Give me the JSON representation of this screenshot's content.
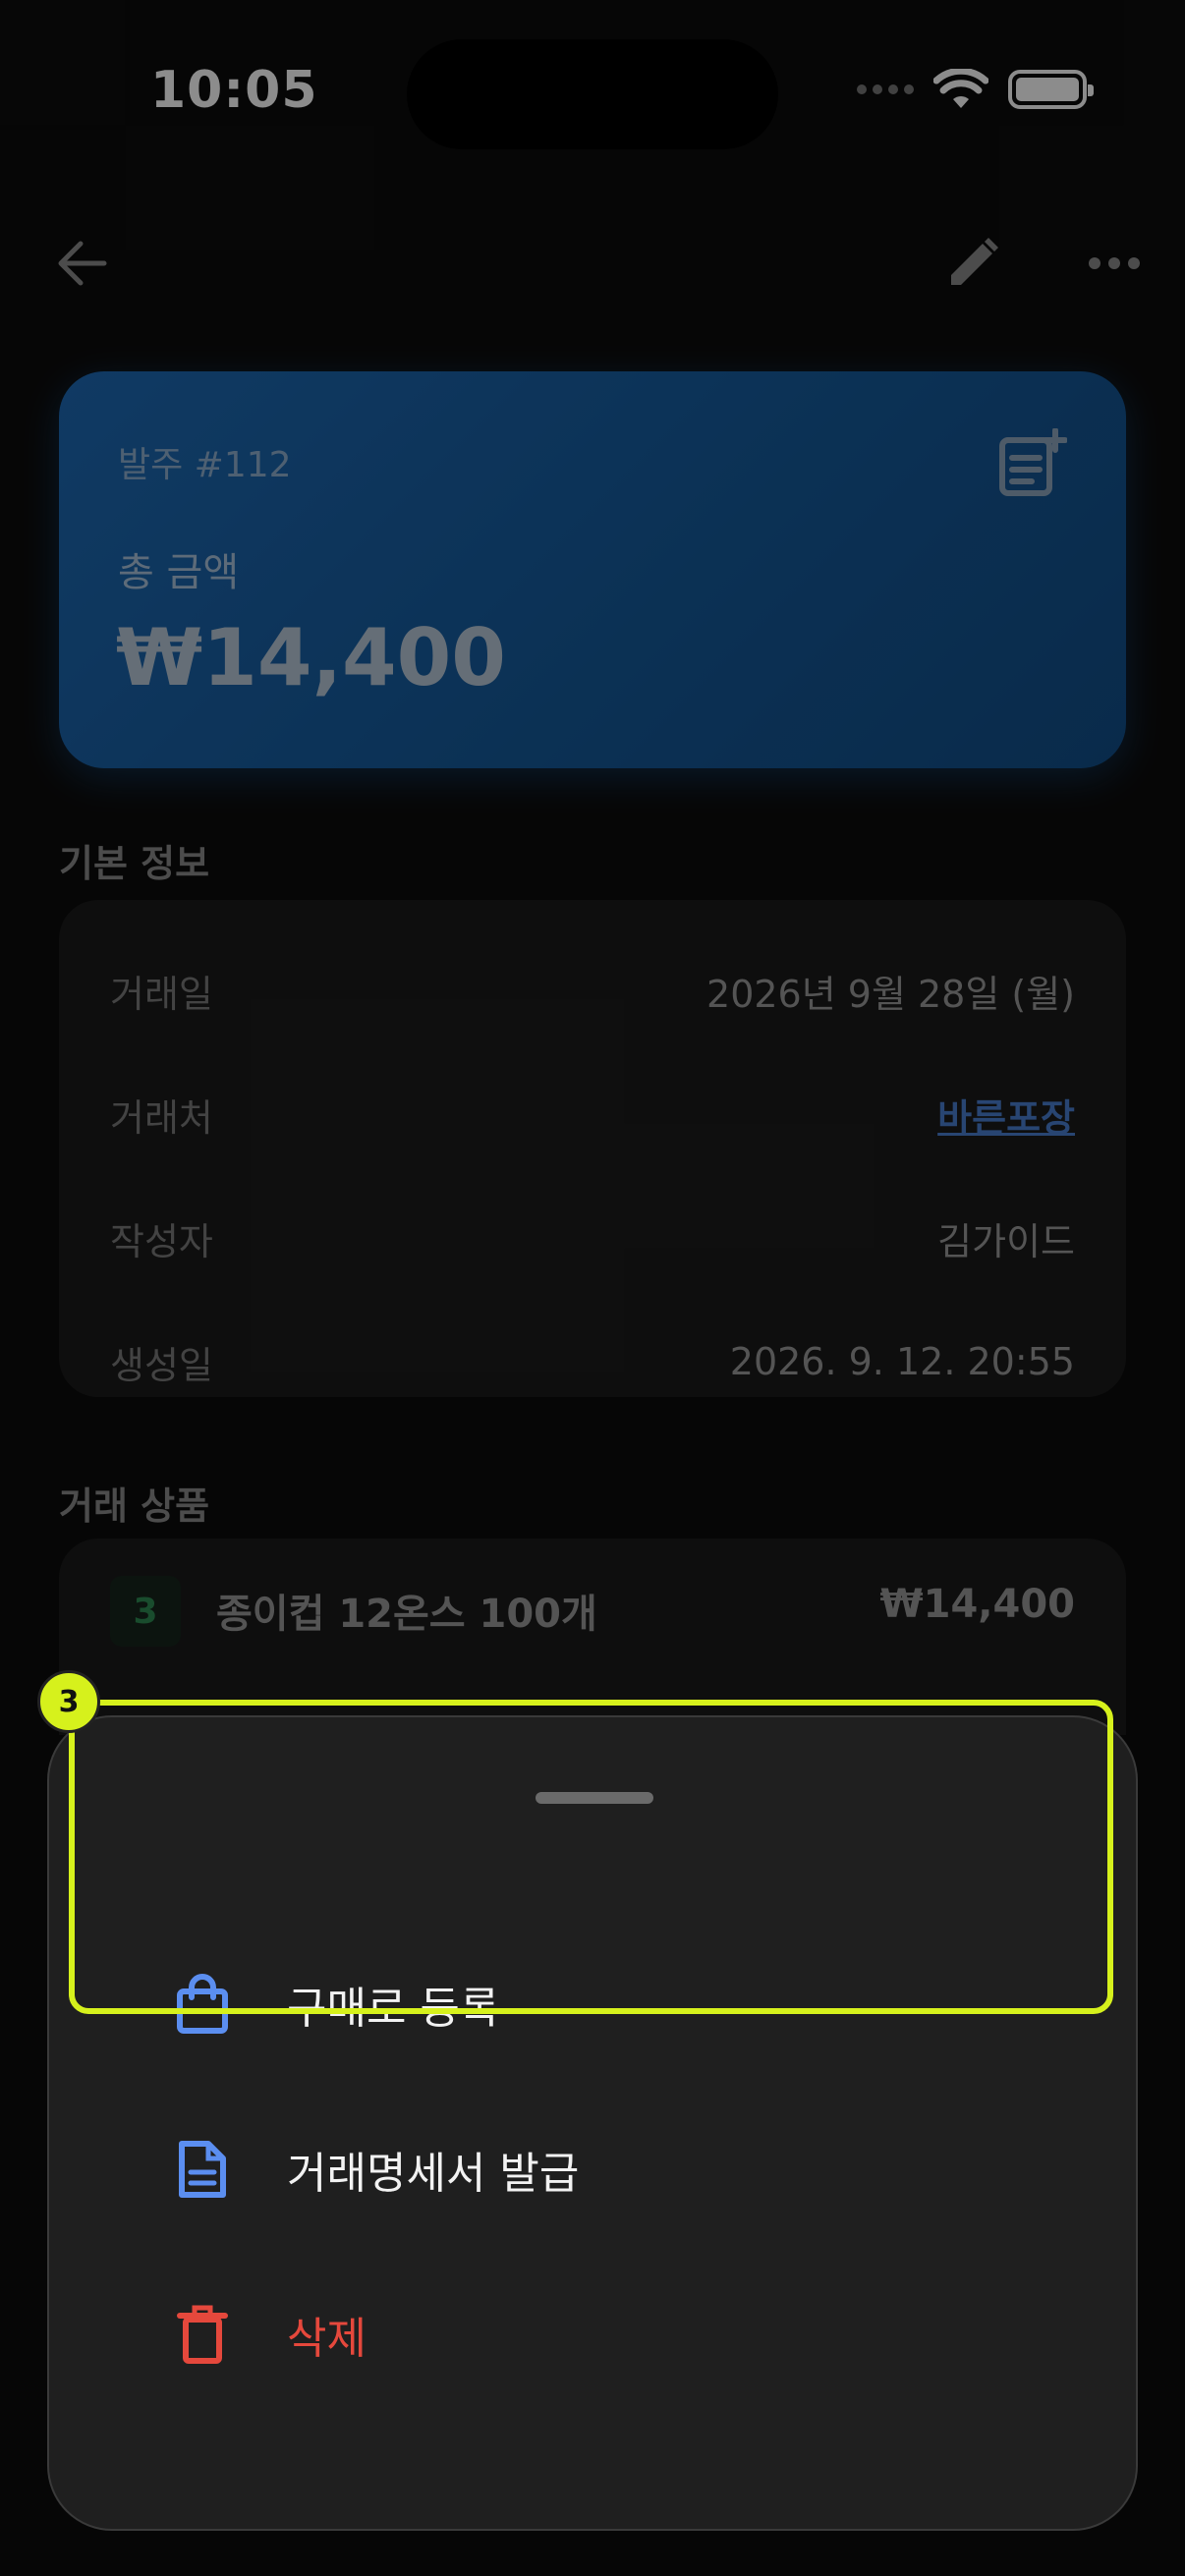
{
  "status_bar": {
    "time": "10:05"
  },
  "order": {
    "number": "발주 #112",
    "total_label": "총 금액",
    "total_amount": "₩14,400"
  },
  "basic_info": {
    "title": "기본 정보",
    "rows": [
      {
        "key": "거래일",
        "value": "2026년 9월 28일 (월)"
      },
      {
        "key": "거래처",
        "value": "바른포장"
      },
      {
        "key": "작성자",
        "value": "김가이드"
      },
      {
        "key": "생성일",
        "value": "2026. 9. 12. 20:55"
      }
    ]
  },
  "items": {
    "title": "거래 상품",
    "list": [
      {
        "qty": "3",
        "name": "종이컵 12온스 100개",
        "price": "₩14,400"
      }
    ]
  },
  "sheet": {
    "actions": [
      {
        "label": "구매로 등록",
        "icon": "shopping-bag-icon"
      },
      {
        "label": "거래명세서 발급",
        "icon": "document-icon"
      },
      {
        "label": "삭제",
        "icon": "trash-icon"
      }
    ]
  },
  "annotation": {
    "marker": "3"
  },
  "colors": {
    "accent_blue": "#1e6ab5",
    "link_blue": "#4a7fd0",
    "danger_red": "#e5483c",
    "icon_blue": "#5b8ef0",
    "highlight": "#d6f11c"
  }
}
